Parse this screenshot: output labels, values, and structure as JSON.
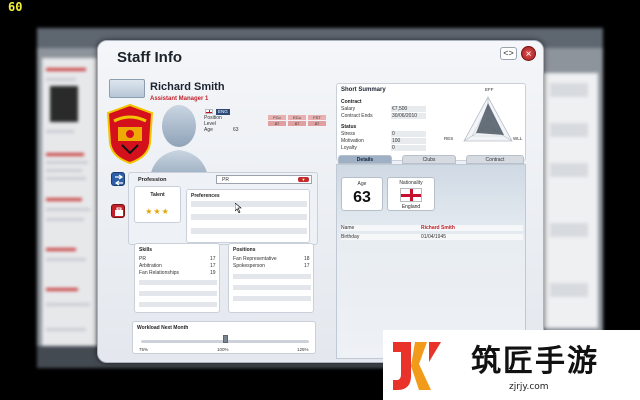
{
  "fps": "60",
  "dialog": {
    "title": "Staff Info",
    "nav_icon": "<>",
    "close_icon": "×"
  },
  "staff": {
    "name": "Richard Smith",
    "role": "Assistant Manager 1",
    "nationality_code": "ENG",
    "fields": [
      {
        "label": "Position",
        "value": ""
      },
      {
        "label": "Level",
        "value": ""
      },
      {
        "label": "Age",
        "value": "63"
      }
    ],
    "attr_headers": [
      "FCo",
      "ECo",
      "FST"
    ],
    "attr_values": [
      "87",
      "87",
      "87"
    ]
  },
  "profession": {
    "label": "Profession",
    "value": "PR",
    "talent_label": "Talent",
    "stars": "★★★",
    "preferences_label": "Preferences"
  },
  "skills": {
    "label": "Skills",
    "items": [
      {
        "name": "PR",
        "value": "17"
      },
      {
        "name": "Arbitration",
        "value": "17"
      },
      {
        "name": "Fan Relationships",
        "value": "19"
      }
    ]
  },
  "positions": {
    "label": "Positions",
    "items": [
      {
        "name": "Fan Representative",
        "value": "18"
      },
      {
        "name": "Spokesperson",
        "value": "17"
      }
    ]
  },
  "workload": {
    "label": "Workload Next Month",
    "ticks": [
      "75%",
      "100%",
      "125%"
    ],
    "level": 1.0
  },
  "summary": {
    "title": "Short Summary",
    "contract_label": "Contract",
    "contract": [
      {
        "label": "Salary",
        "value": "€7,500"
      },
      {
        "label": "Contract Ends",
        "value": "30/06/2010"
      }
    ],
    "status_label": "Status",
    "status": [
      {
        "label": "Stress",
        "value": "0"
      },
      {
        "label": "Motivation",
        "value": "100"
      },
      {
        "label": "Loyalty",
        "value": "0"
      }
    ],
    "radar_labels": [
      "EFF",
      "RES",
      "WLL"
    ]
  },
  "tabs": [
    {
      "label": "Details",
      "active": true
    },
    {
      "label": "Clubs",
      "active": false
    },
    {
      "label": "Contract",
      "active": false
    }
  ],
  "details": {
    "age_label": "Age",
    "age_value": "63",
    "nationality_label": "Nationality",
    "nationality_value": "England",
    "rows": [
      {
        "label": "Name",
        "value": "Richard Smith"
      },
      {
        "label": "Birthday",
        "value": "01/04/1945"
      }
    ]
  },
  "watermark": {
    "brand_cn": "筑匠手游",
    "url": "zjrjy.com"
  },
  "colors": {
    "accent_red": "#c0212a",
    "fps_yellow": "#f2ee3a"
  }
}
